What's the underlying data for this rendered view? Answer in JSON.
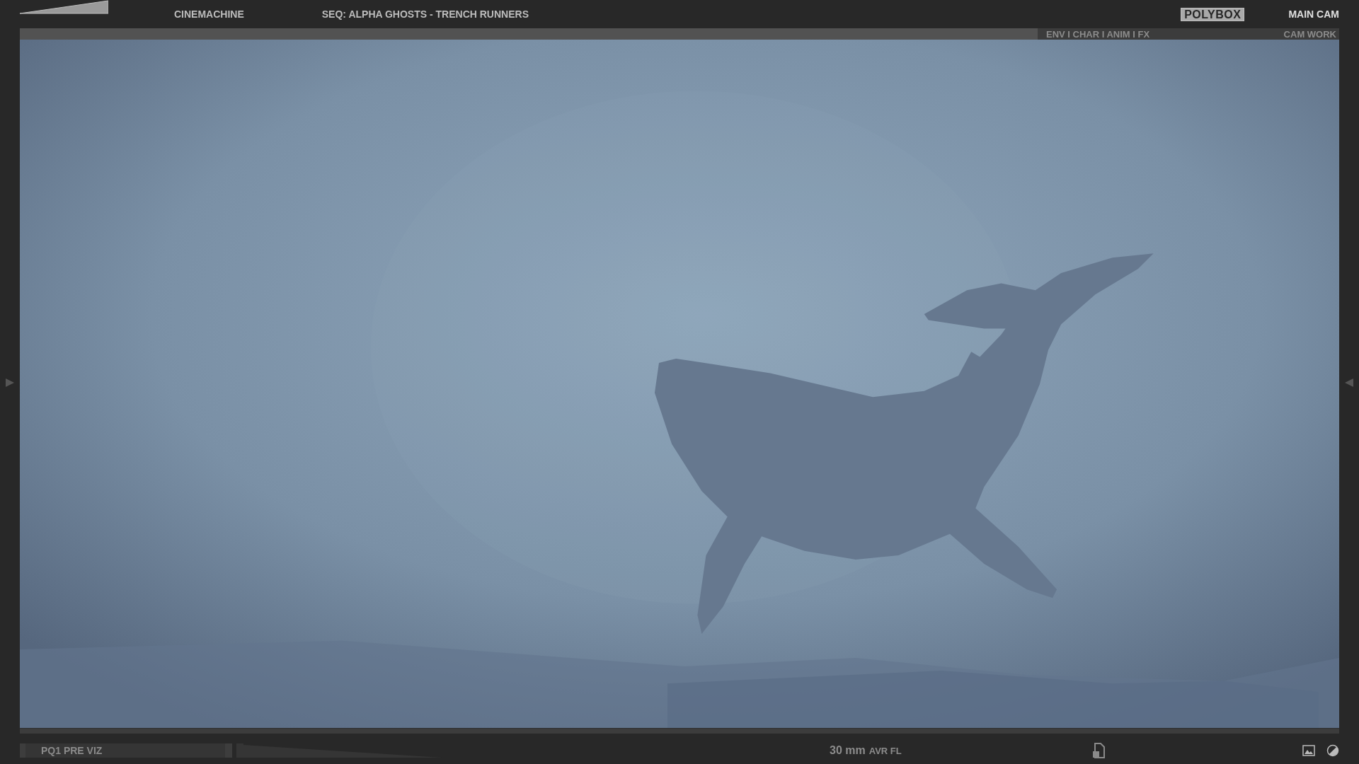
{
  "header": {
    "app": "CINEMACHINE",
    "sequence_label": "SEQ:",
    "sequence": "ALPHA GHOSTS - TRENCH RUNNERS",
    "brand": "POLYBOX",
    "camera": "MAIN CAM"
  },
  "viewport": {
    "departments": "ENV I CHAR I ANIM I FX",
    "mode": "CAM WORK",
    "kind": "picture"
  },
  "footer": {
    "shot": "PQ1 PRE VIZ",
    "focal_value": "30 mm",
    "focal_label": "AVR FL"
  }
}
